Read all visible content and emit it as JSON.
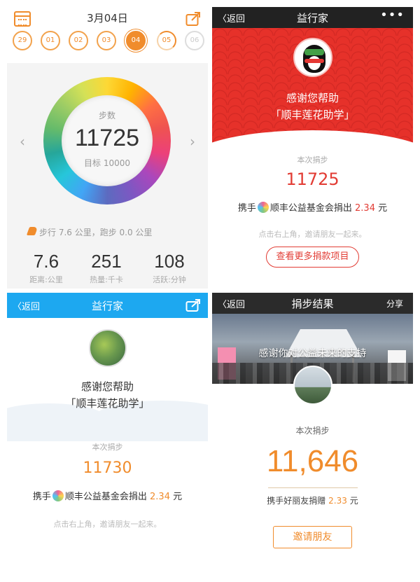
{
  "panel1": {
    "date_title": "3月04日",
    "days": [
      "29",
      "01",
      "02",
      "03",
      "04",
      "05",
      "06"
    ],
    "steps_label": "步数",
    "steps_value": "11725",
    "goal_text": "目标 10000",
    "walk_text": "步行 7.6 公里，跑步 0.0 公里",
    "stats": [
      {
        "value": "7.6",
        "label": "距离:公里"
      },
      {
        "value": "251",
        "label": "热量:千卡"
      },
      {
        "value": "108",
        "label": "活跃:分钟"
      }
    ],
    "accent_color": "#f08c2c"
  },
  "panel2": {
    "back_label": "返回",
    "title": "益行家",
    "more_icon": "more-dots-icon",
    "thanks_line1": "感谢您帮助",
    "thanks_line2": "「顺丰莲花助学」",
    "donate_label": "本次捐步",
    "donate_value": "11725",
    "donor_prefix": "携手",
    "donor_org": "顺丰公益基金会捐出",
    "donor_amount": "2.34",
    "donor_unit": "元",
    "hint": "点击右上角，邀请朋友一起来。",
    "button_label": "查看更多捐款项目",
    "header_color": "#e6312a"
  },
  "panel3": {
    "back_label": "返回",
    "title": "益行家",
    "thanks_line1": "感谢您帮助",
    "thanks_line2": "「顺丰莲花助学」",
    "donate_label": "本次捐步",
    "donate_value": "11730",
    "donor_prefix": "携手",
    "donor_org": "顺丰公益基金会捐出",
    "donor_amount": "2.34",
    "donor_unit": "元",
    "hint": "点击右上角，邀请朋友一起来。",
    "nav_color": "#1da8f0"
  },
  "panel4": {
    "back_label": "返回",
    "title": "捐步结果",
    "share_label": "分享",
    "banner_text": "感谢你对公益未来的支持",
    "donate_label": "本次捐步",
    "donate_value": "11,646",
    "donor_text": "携手好丽友捐赠",
    "donor_amount": "2.33",
    "donor_unit": "元",
    "button_label": "邀请朋友"
  }
}
